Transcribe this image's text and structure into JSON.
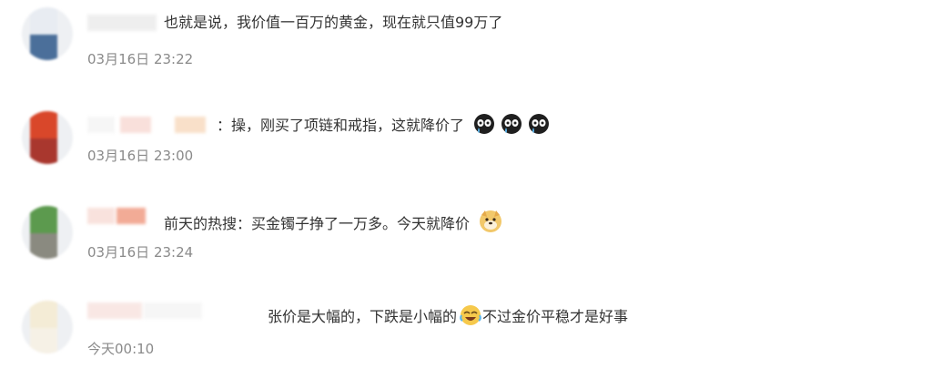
{
  "comments": [
    {
      "text": "也就是说，我价值一百万的黄金，现在就只值99万了",
      "time": "03月16日 23:22",
      "avatar_colors": [
        "#e8ecf2",
        "#4b6f9a"
      ],
      "emojis": []
    },
    {
      "prefix": "：",
      "text": "操，刚买了项链和戒指，这就降价了",
      "time": "03月16日 23:00",
      "avatar_colors": [
        "#d9472a",
        "#a9372e"
      ],
      "emojis": [
        "crying-face",
        "crying-face",
        "crying-face"
      ]
    },
    {
      "text": "前天的热搜：买金镯子挣了一万多。今天就降价",
      "time": "03月16日 23:24",
      "avatar_colors": [
        "#5c9a4e",
        "#8a8a80"
      ],
      "emojis": [
        "doge"
      ]
    },
    {
      "text": "张价是大幅的，下跌是小幅的",
      "text2": "不过金价平稳才是好事",
      "time": "今天00:10",
      "avatar_colors": [
        "#f4ecd6",
        "#f6f1e6"
      ],
      "emojis": [
        "laughing-face"
      ]
    }
  ]
}
